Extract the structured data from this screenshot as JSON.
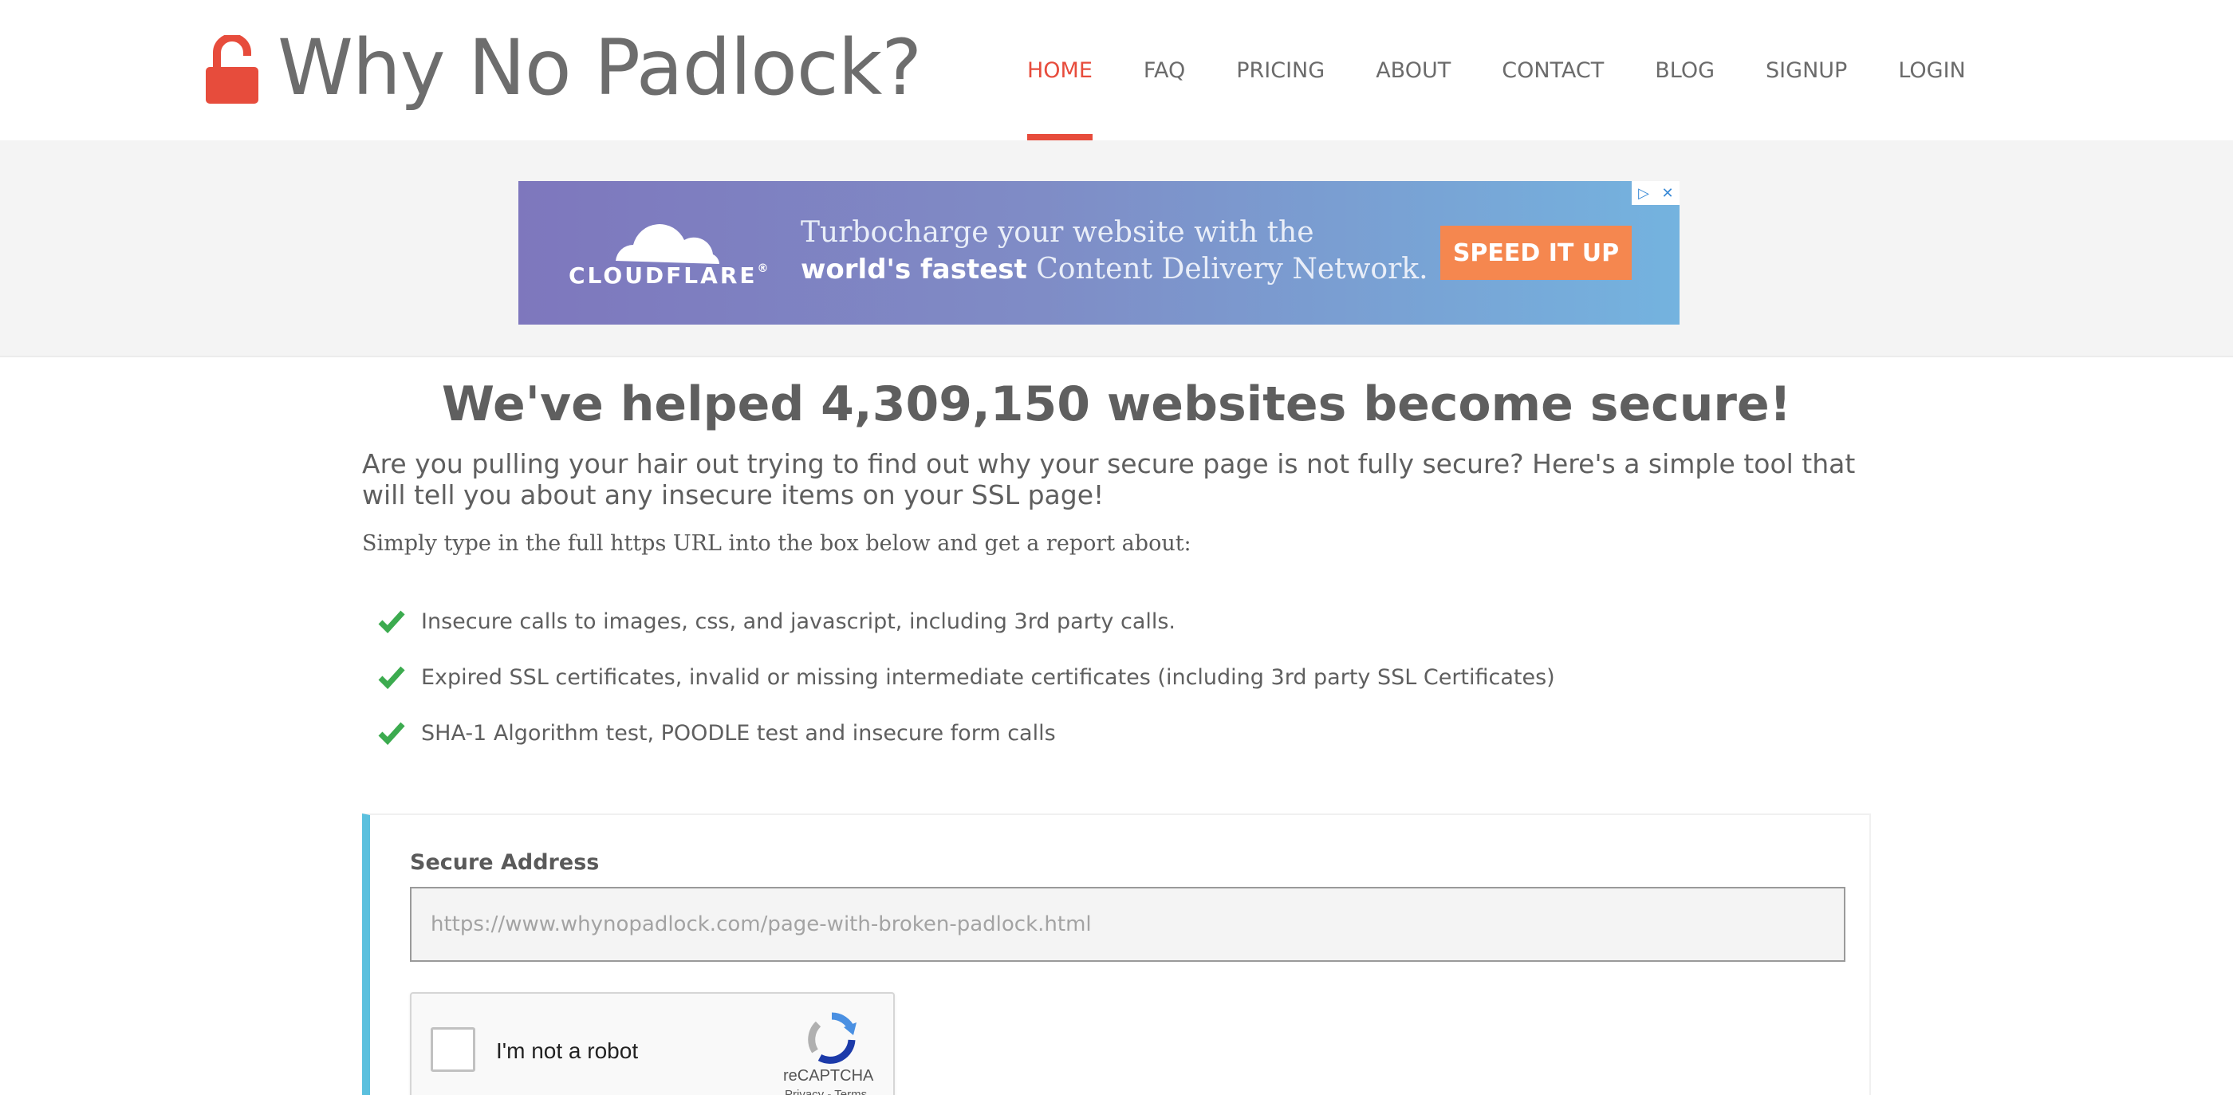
{
  "site": {
    "title": "Why No Padlock?",
    "logo_icon": "open-padlock-icon",
    "brand_color": "#e74c3c"
  },
  "nav": {
    "items": [
      {
        "label": "HOME",
        "active": true
      },
      {
        "label": "FAQ",
        "active": false
      },
      {
        "label": "PRICING",
        "active": false
      },
      {
        "label": "ABOUT",
        "active": false
      },
      {
        "label": "CONTACT",
        "active": false
      },
      {
        "label": "BLOG",
        "active": false
      },
      {
        "label": "SIGNUP",
        "active": false
      },
      {
        "label": "LOGIN",
        "active": false
      }
    ]
  },
  "ad": {
    "brand": "CLOUDFLARE",
    "brand_mark": "®",
    "line1": "Turbocharge your website with the",
    "line2_bold": "world's fastest",
    "line2_rest": " Content Delivery Network.",
    "cta": "SPEED IT UP",
    "cta_color": "#f5874f",
    "controls": [
      "adchoices-icon",
      "close-icon"
    ]
  },
  "main": {
    "headline": "We've helped 4,309,150 websites become secure!",
    "lead": "Are you pulling your hair out trying to find out why your secure page is not fully secure? Here's a simple tool that will tell you about any insecure items on your SSL page!",
    "intro": "Simply type in the full https URL into the box below and get a report about:",
    "features": [
      "Insecure calls to images, css, and javascript, including 3rd party calls.",
      "Expired SSL certificates, invalid or missing intermediate certificates (including 3rd party SSL Certificates)",
      "SHA-1 Algorithm test, POODLE test and insecure form calls"
    ],
    "check_color": "#3cab4f"
  },
  "form": {
    "label": "Secure Address",
    "input_value": "",
    "input_placeholder": "https://www.whynopadlock.com/page-with-broken-padlock.html",
    "accent_color": "#5bc0de"
  },
  "captcha": {
    "label": "I'm not a robot",
    "brand": "reCAPTCHA",
    "links": "Privacy - Terms"
  }
}
